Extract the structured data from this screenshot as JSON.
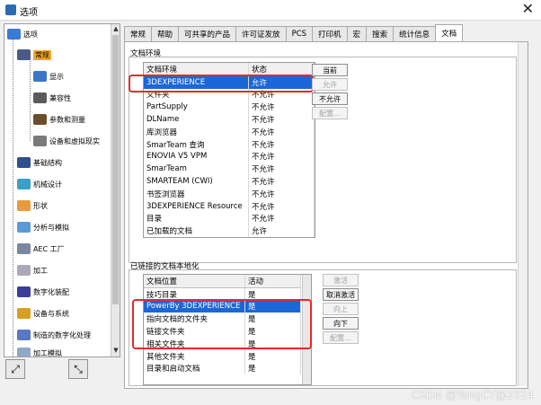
{
  "window": {
    "title": "选项",
    "close_glyph": "✕"
  },
  "tree": {
    "items": [
      {
        "label": "选项",
        "icon": "options-root-icon",
        "level": 0
      },
      {
        "label": "常规",
        "icon": "general-icon",
        "level": 1,
        "selected": true
      },
      {
        "label": "显示",
        "icon": "display-icon",
        "level": 2
      },
      {
        "label": "兼容性",
        "icon": "compatibility-icon",
        "level": 2
      },
      {
        "label": "参数和测量",
        "icon": "parameters-icon",
        "level": 2
      },
      {
        "label": "设备和虚拟现实",
        "icon": "devices-vr-icon",
        "level": 2
      },
      {
        "label": "基础结构",
        "icon": "infrastructure-icon",
        "level": 1
      },
      {
        "label": "机械设计",
        "icon": "mechanical-design-icon",
        "level": 1
      },
      {
        "label": "形状",
        "icon": "shape-icon",
        "level": 1
      },
      {
        "label": "分析与模拟",
        "icon": "analysis-icon",
        "level": 1
      },
      {
        "label": "AEC 工厂",
        "icon": "aec-plant-icon",
        "level": 1
      },
      {
        "label": "加工",
        "icon": "machining-icon",
        "level": 1
      },
      {
        "label": "数字化装配",
        "icon": "digital-mockup-icon",
        "level": 1
      },
      {
        "label": "设备与系统",
        "icon": "equipment-systems-icon",
        "level": 1
      },
      {
        "label": "制造的数字化处理",
        "icon": "digital-manufacturing-icon",
        "level": 1
      },
      {
        "label": "加工模拟",
        "icon": "machining-simulation-icon",
        "level": 1
      }
    ]
  },
  "tabs": [
    "常规",
    "帮助",
    "可共享的产品",
    "许可证发放",
    "PCS",
    "打印机",
    "宏",
    "搜索",
    "统计信息",
    "文档"
  ],
  "active_tab": "文档",
  "doc_env": {
    "group_label": "文档环境",
    "columns": [
      "文档环境",
      "状态"
    ],
    "rows": [
      [
        "3DEXPERIENCE",
        "允许"
      ],
      [
        "文件夹",
        "不允许"
      ],
      [
        "PartSupply",
        "不允许"
      ],
      [
        "DLName",
        "不允许"
      ],
      [
        "库浏览器",
        "不允许"
      ],
      [
        "SmarTeam 查询",
        "不允许"
      ],
      [
        "ENOVIA V5 VPM",
        "不允许"
      ],
      [
        "SmarTeam",
        "不允许"
      ],
      [
        "SMARTEAM (CWI)",
        "不允许"
      ],
      [
        "书签浏览器",
        "不允许"
      ],
      [
        "3DEXPERIENCE Resource",
        "不允许"
      ],
      [
        "目录",
        "不允许"
      ],
      [
        "已加载的文档",
        "允许"
      ]
    ],
    "buttons": [
      {
        "label": "当前",
        "enabled": true
      },
      {
        "label": "允许",
        "enabled": false
      },
      {
        "label": "不允许",
        "enabled": true
      },
      {
        "label": "配置...",
        "enabled": false
      }
    ]
  },
  "linked_docs": {
    "group_label": "已链接的文档本地化",
    "columns": [
      "文档位置",
      "活动"
    ],
    "rows": [
      [
        "技巧目录",
        "是"
      ],
      [
        "PowerBy 3DEXPERIENCE",
        "是"
      ],
      [
        "指向文档的文件夹",
        "是"
      ],
      [
        "链接文件夹",
        "是"
      ],
      [
        "相关文件夹",
        "是"
      ],
      [
        "其他文件夹",
        "是"
      ],
      [
        "目录和启动文档",
        "是"
      ]
    ],
    "buttons": [
      {
        "label": "激活",
        "enabled": false
      },
      {
        "label": "取消激活",
        "enabled": true
      },
      {
        "label": "向上",
        "enabled": false
      },
      {
        "label": "向下",
        "enabled": true
      },
      {
        "label": "配置...",
        "enabled": false
      }
    ]
  },
  "watermark": "CSDN @YangCY@2024",
  "colors": {
    "selection": "#1b67d8",
    "highlight_box": "#e8282a",
    "tree_selected": "#f5a623"
  }
}
